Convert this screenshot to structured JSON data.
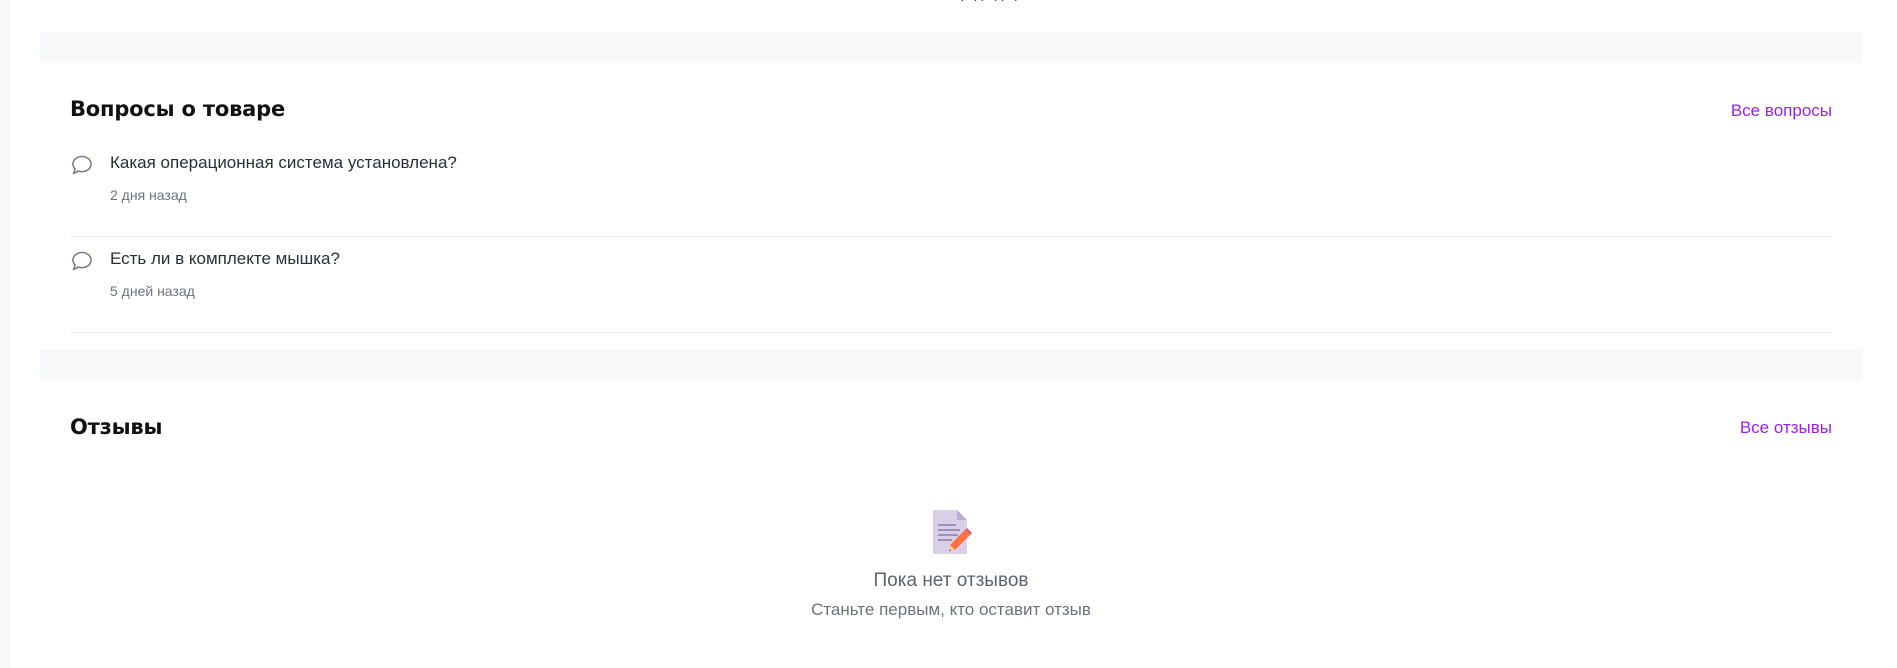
{
  "top_cutoff": {
    "text": "· ·· ·· ·"
  },
  "questions": {
    "title": "Вопросы о товаре",
    "all_link": "Все вопросы",
    "items": [
      {
        "text": "Какая операционная система установлена?",
        "date": "2 дня назад",
        "icon": "chat-bubble-icon"
      },
      {
        "text": "Есть ли в комплекте мышка?",
        "date": "5 дней назад",
        "icon": "chat-bubble-icon"
      }
    ]
  },
  "reviews": {
    "title": "Отзывы",
    "all_link": "Все отзывы",
    "empty": {
      "icon": "memo-pencil-icon",
      "title": "Пока нет отзывов",
      "subtitle": "Станьте первым, кто оставит отзыв"
    }
  },
  "colors": {
    "accent": "#a11ef0",
    "band": "#f7f8fa",
    "divider": "#eceef2"
  }
}
